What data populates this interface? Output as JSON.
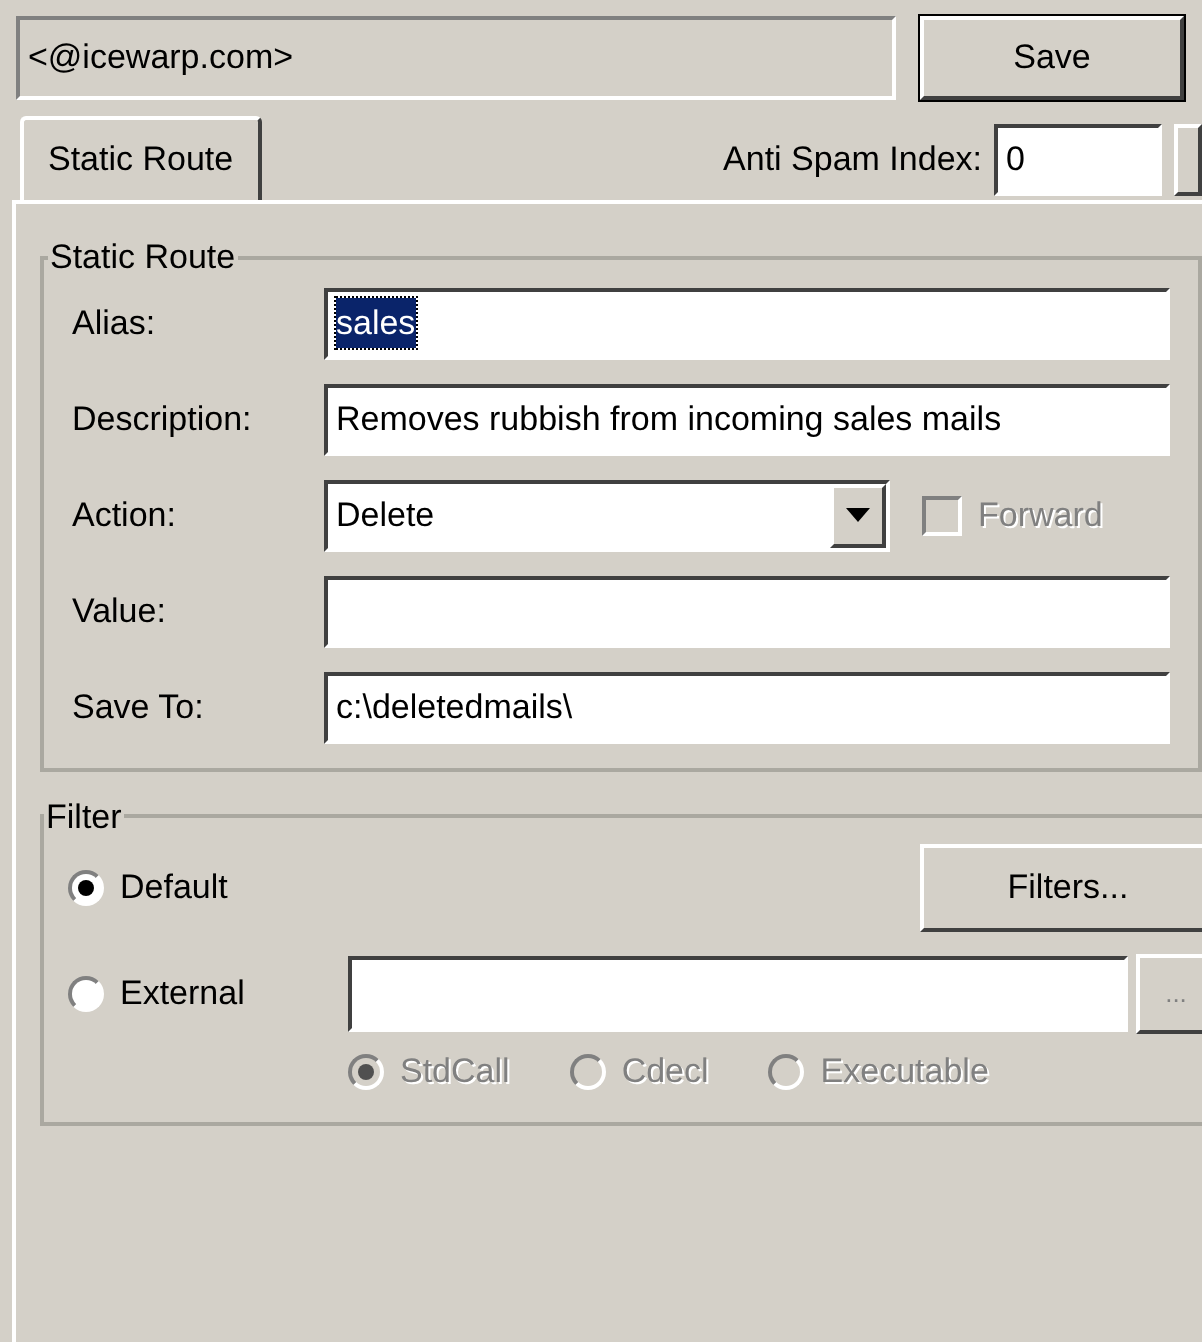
{
  "header": {
    "account": "<@icewarp.com>",
    "save_button": "Save"
  },
  "tabs": [
    {
      "label": "Static Route",
      "selected": true
    }
  ],
  "anti_spam_index": {
    "label": "Anti Spam Index:",
    "value": "0"
  },
  "static_route": {
    "title": "Static Route",
    "fields": [
      {
        "kind": "text",
        "label": "Alias:",
        "value": "sales",
        "value_selected": true
      },
      {
        "kind": "text",
        "label": "Description:",
        "value": "Removes rubbish from incoming sales mails"
      },
      {
        "kind": "select",
        "label": "Action:",
        "value": "Delete",
        "checkbox": {
          "label": "Forward",
          "checked": false,
          "disabled": true
        }
      },
      {
        "kind": "text",
        "label": "Value:"
      },
      {
        "kind": "text",
        "label": "Save To:",
        "value": "c:\\deletedmails\\"
      }
    ]
  },
  "filter": {
    "title": "Filter",
    "options": [
      {
        "label": "Default",
        "selected": true
      },
      {
        "label": "External",
        "selected": false
      }
    ],
    "filters_button": "Filters...",
    "browse_button": "...",
    "call_types": [
      {
        "label": "StdCall",
        "selected": true,
        "disabled": true
      },
      {
        "label": "Cdecl",
        "selected": false,
        "disabled": true
      },
      {
        "label": "Executable",
        "selected": false,
        "disabled": true
      }
    ]
  }
}
